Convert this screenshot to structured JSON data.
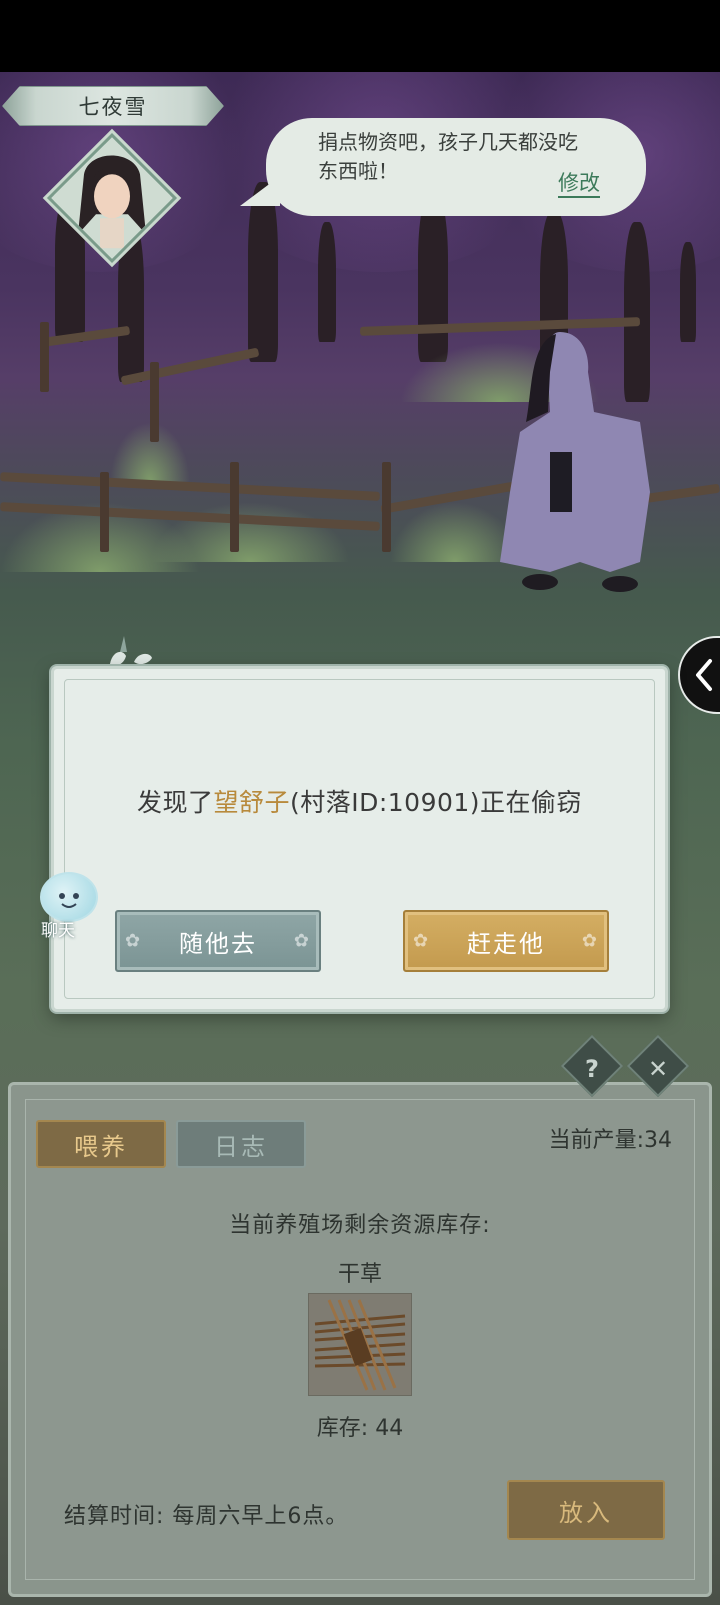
{
  "npc": {
    "name": "七夜雪",
    "speech": "捐点物资吧，孩子几天都没吃东西啦！",
    "edit_label": "修改"
  },
  "modal": {
    "message_prefix": "发现了",
    "thief_name": "望舒子",
    "message_suffix": "(村落ID:10901)正在偷窃",
    "ignore_label": "随他去",
    "chase_label": "赶走他",
    "highlight_color": "#b88a3c"
  },
  "chat": {
    "label": "聊天"
  },
  "farm": {
    "tabs": [
      {
        "label": "喂养",
        "active": true
      },
      {
        "label": "日志",
        "active": false
      }
    ],
    "production": "当前产量:34",
    "stock_title": "当前养殖场剩余资源库存:",
    "item_name": "干草",
    "item_stock": "库存: 44",
    "settle_time": "结算时间: 每周六早上6点。",
    "put_label": "放入",
    "help_glyph": "?",
    "close_glyph": "✕"
  },
  "icons": {
    "side_toggle": "chevron-left-icon",
    "help": "question-icon",
    "close": "close-icon",
    "hay": "hay-bundle-icon"
  }
}
